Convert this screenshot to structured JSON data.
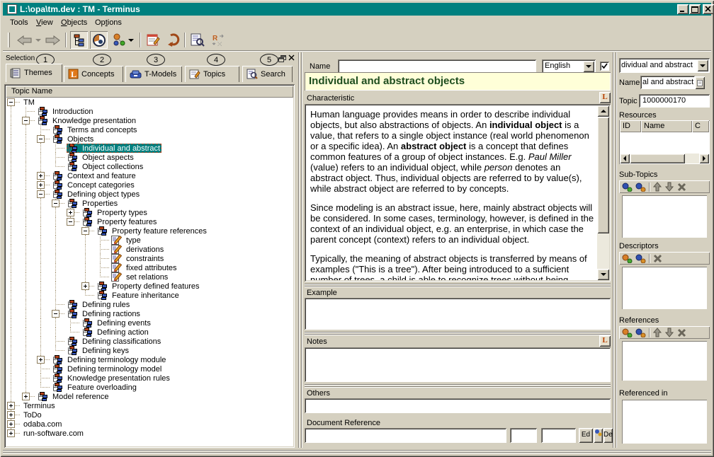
{
  "window": {
    "title": "L:\\opa\\tm.dev : TM - Terminus"
  },
  "menu": {
    "items": [
      {
        "label": "Tools"
      },
      {
        "label": "View",
        "u": 0
      },
      {
        "label": "Objects",
        "u": 0
      },
      {
        "label": "Options",
        "u": 2
      }
    ]
  },
  "selection_panel": {
    "header": "Selection",
    "callouts": [
      "1",
      "2",
      "3",
      "4",
      "5"
    ],
    "tabs": [
      {
        "label": "Themes",
        "active": true
      },
      {
        "label": "Concepts",
        "active": false
      },
      {
        "label": "T-Models",
        "active": false
      },
      {
        "label": "Topics",
        "active": false
      },
      {
        "label": "Search",
        "active": false
      }
    ],
    "tree_header": "Topic Name",
    "tree": [
      {
        "label": "TM",
        "level": 0,
        "exp": "minus",
        "icon": null
      },
      {
        "label": "Introduction",
        "level": 1,
        "exp": null,
        "icon": "topic"
      },
      {
        "label": "Knowledge presentation",
        "level": 1,
        "exp": "minus",
        "icon": "topic"
      },
      {
        "label": "Terms and concepts",
        "level": 2,
        "exp": null,
        "icon": "topic"
      },
      {
        "label": "Objects",
        "level": 2,
        "exp": "minus",
        "icon": "topic"
      },
      {
        "label": "Individual and abstract",
        "level": 3,
        "exp": null,
        "icon": "topic",
        "selected": true
      },
      {
        "label": "Object aspects",
        "level": 3,
        "exp": null,
        "icon": "topic"
      },
      {
        "label": "Object collections",
        "level": 3,
        "exp": null,
        "icon": "topic"
      },
      {
        "label": "Context and feature",
        "level": 2,
        "exp": "plus",
        "icon": "topic"
      },
      {
        "label": "Concept categories",
        "level": 2,
        "exp": "plus",
        "icon": "topic"
      },
      {
        "label": "Defining object types",
        "level": 2,
        "exp": "minus",
        "icon": "topic"
      },
      {
        "label": "Properties",
        "level": 3,
        "exp": "minus",
        "icon": "topic"
      },
      {
        "label": "Property types",
        "level": 4,
        "exp": "plus",
        "icon": "topic"
      },
      {
        "label": "Property features",
        "level": 4,
        "exp": "minus",
        "icon": "topic"
      },
      {
        "label": "Property feature references",
        "level": 5,
        "exp": "minus",
        "icon": "topic"
      },
      {
        "label": "type",
        "level": 6,
        "exp": null,
        "icon": "pencil"
      },
      {
        "label": "derivations",
        "level": 6,
        "exp": null,
        "icon": "pencil"
      },
      {
        "label": "constraints",
        "level": 6,
        "exp": null,
        "icon": "pencil"
      },
      {
        "label": "fixed attributes",
        "level": 6,
        "exp": null,
        "icon": "pencil"
      },
      {
        "label": "set relations",
        "level": 6,
        "exp": null,
        "icon": "pencil"
      },
      {
        "label": "Property defined features",
        "level": 5,
        "exp": "plus",
        "icon": "topic"
      },
      {
        "label": "Feature inheritance",
        "level": 5,
        "exp": null,
        "icon": "topic"
      },
      {
        "label": "Defining rules",
        "level": 3,
        "exp": null,
        "icon": "topic"
      },
      {
        "label": "Defining ractions",
        "level": 3,
        "exp": "minus",
        "icon": "topic"
      },
      {
        "label": "Defining events",
        "level": 4,
        "exp": null,
        "icon": "topic"
      },
      {
        "label": "Defining action",
        "level": 4,
        "exp": null,
        "icon": "topic"
      },
      {
        "label": "Defining classifications",
        "level": 3,
        "exp": null,
        "icon": "topic"
      },
      {
        "label": "Defining keys",
        "level": 3,
        "exp": null,
        "icon": "topic"
      },
      {
        "label": "Defining terminology module",
        "level": 2,
        "exp": "plus",
        "icon": "topic"
      },
      {
        "label": "Defining terminology model",
        "level": 2,
        "exp": null,
        "icon": "topic"
      },
      {
        "label": "Knowledge presentation rules",
        "level": 2,
        "exp": null,
        "icon": "topic"
      },
      {
        "label": "Feature overloading",
        "level": 2,
        "exp": null,
        "icon": "topic"
      },
      {
        "label": "Model reference",
        "level": 1,
        "exp": "plus",
        "icon": "topic"
      },
      {
        "label": "Terminus",
        "level": 0,
        "exp": "plus",
        "icon": null
      },
      {
        "label": "ToDo",
        "level": 0,
        "exp": "plus",
        "icon": null
      },
      {
        "label": "odaba.com",
        "level": 0,
        "exp": "plus",
        "icon": null
      },
      {
        "label": "run-software.com",
        "level": 0,
        "exp": "plus",
        "icon": null
      }
    ]
  },
  "detail_panel": {
    "name_label": "Name",
    "name_value": "",
    "language_value": "English",
    "language_enabled": true,
    "title": "Individual and abstract objects",
    "characteristic_label": "Characteristic",
    "characteristic_paragraphs": [
      [
        {
          "t": "Human language provides means in order to describe individual objects, but also abstractions of objects. An "
        },
        {
          "t": "individual object",
          "s": "b"
        },
        {
          "t": " is a value, that refers to a single object instance (real world phenomenon or a specific idea). An "
        },
        {
          "t": "abstract object",
          "s": "b"
        },
        {
          "t": " is a concept that defines common features of a group of object instances. E.g. "
        },
        {
          "t": "Paul Miller",
          "s": "i"
        },
        {
          "t": " (value) refers to an individual object, while "
        },
        {
          "t": "person",
          "s": "i"
        },
        {
          "t": " denotes an abstract object. Thus, individual objects are referred to by value(s), while abstract object are referred to by concepts."
        }
      ],
      [
        {
          "t": "Since modeling is an abstract issue, here, mainly abstract objects will be considered. In some cases, terminology, however, is defined in the context of an individual object, e.g. an enterprise, in which case the parent concept (context) refers to an individual object."
        }
      ],
      [
        {
          "t": "Typically, the meaning of abstract objects is transferred by means of examples (\"This is a tree\"). After being introduced to a sufficient number of trees, a child is able to recognize trees without being introduced to all trees."
        }
      ]
    ],
    "example_label": "Example",
    "example_value": "",
    "notes_label": "Notes",
    "notes_value": "",
    "others_label": "Others",
    "others_value": "",
    "docref_label": "Document Reference",
    "docref_value": "",
    "docref_page": "",
    "docref_pos": "",
    "edit_button": "Ed",
    "del_button": "Del"
  },
  "topic_panel": {
    "combo_value": "dividual and abstract",
    "name_label": "Name",
    "name_value": "al and abstract",
    "topic_label": "Topic",
    "topic_value": "1000000170",
    "resources_label": "Resources",
    "resources_columns": [
      "ID",
      "Name",
      "C"
    ],
    "subtopics_label": "Sub-Topics",
    "descriptors_label": "Descriptors",
    "references_label": "References",
    "referenced_in_label": "Referenced in"
  }
}
